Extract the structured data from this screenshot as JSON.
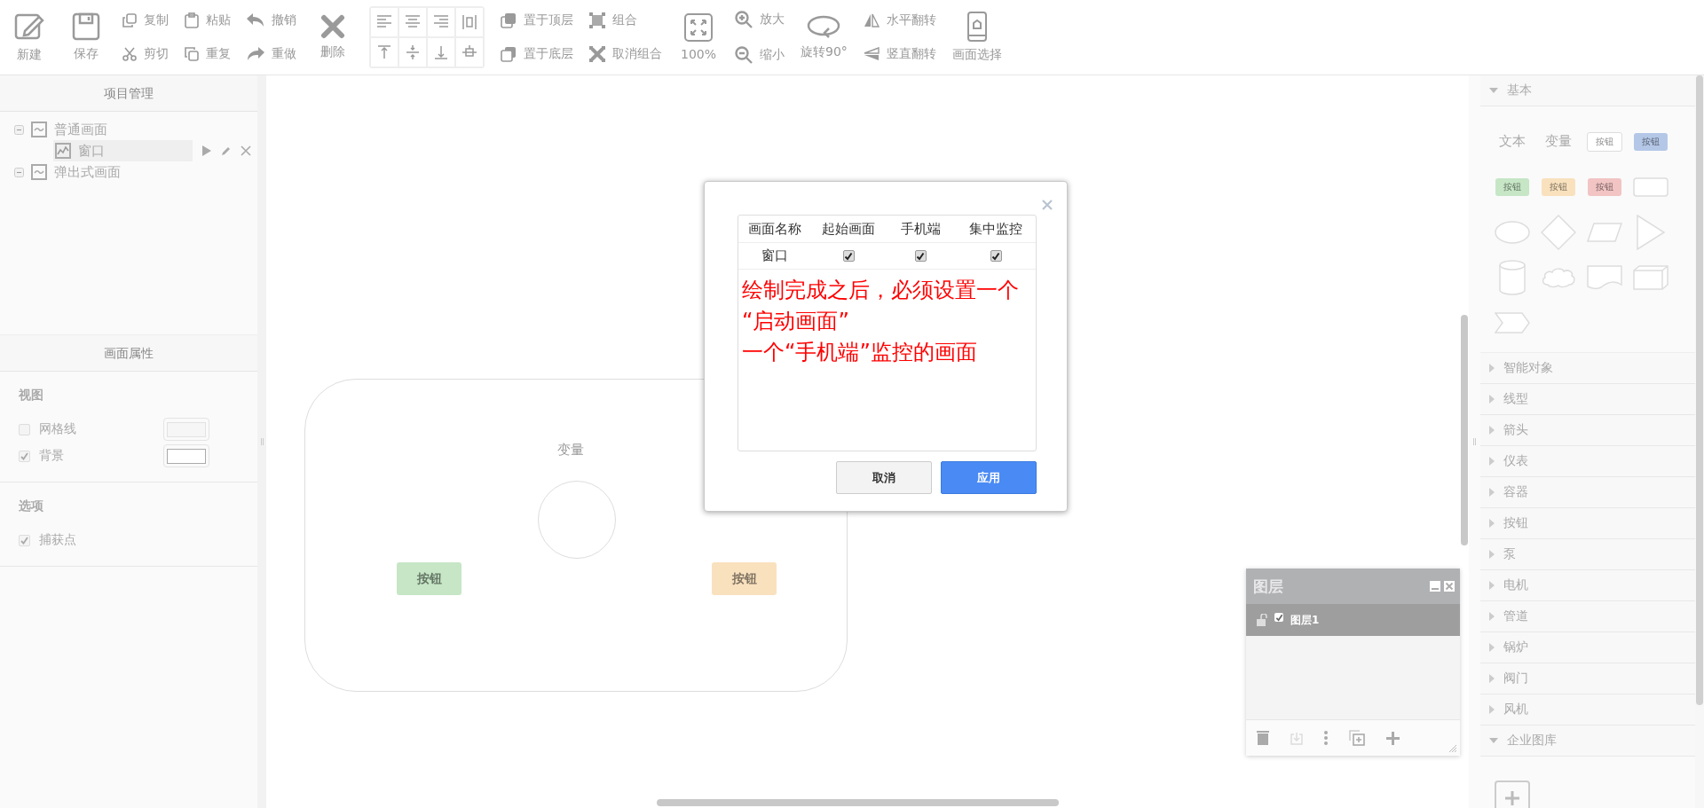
{
  "toolbar": {
    "new": "新建",
    "save": "保存",
    "copy": "复制",
    "cut": "剪切",
    "paste": "粘贴",
    "repeat": "重复",
    "undo": "撤销",
    "redo": "重做",
    "delete": "删除",
    "bring_front": "置于顶层",
    "send_back": "置于底层",
    "group": "组合",
    "ungroup": "取消组合",
    "zoom_reset": "100%",
    "zoom_in": "放大",
    "zoom_out": "缩小",
    "rotate": "旋转90°",
    "flip_h": "水平翻转",
    "flip_v": "竖直翻转",
    "screen_select": "画面选择"
  },
  "project_panel": {
    "title": "项目管理",
    "tree": [
      {
        "label": "普通画面",
        "expanded": true,
        "children": [
          {
            "label": "窗口",
            "selected": true
          }
        ]
      },
      {
        "label": "弹出式画面",
        "expanded": true
      }
    ]
  },
  "properties_panel": {
    "title": "画面属性",
    "sections": [
      {
        "title": "视图",
        "options": [
          {
            "label": "网格线",
            "checked": false,
            "kind": "swatch"
          },
          {
            "label": "背景",
            "checked": true,
            "kind": "swatch"
          }
        ]
      },
      {
        "title": "选项",
        "options": [
          {
            "label": "捕获点",
            "checked": true,
            "kind": "plain"
          }
        ]
      }
    ]
  },
  "canvas": {
    "items": [
      {
        "kind": "text",
        "label": "变量"
      },
      {
        "kind": "circle"
      },
      {
        "kind": "button",
        "label": "按钮",
        "color": "#c6e6c6"
      },
      {
        "kind": "button",
        "label": "按钮",
        "color": "#f9e1be"
      }
    ]
  },
  "dialog": {
    "columns": [
      "画面名称",
      "起始画面",
      "手机端",
      "集中监控"
    ],
    "rows": [
      {
        "name": "窗口",
        "cells": [
          {
            "checked": true
          },
          {
            "checked": true
          },
          {
            "checked": true
          }
        ]
      }
    ],
    "note": [
      "绘制完成之后，必须设置一个",
      "“启动画面”",
      "一个“手机端”监控的画面"
    ],
    "buttons": [
      {
        "label": "取消",
        "kind": "secondary"
      },
      {
        "label": "应用",
        "kind": "primary"
      }
    ]
  },
  "layers_panel": {
    "title": "图层",
    "layers": [
      {
        "name": "图层1",
        "visible": true,
        "locked": false,
        "selected": true
      }
    ]
  },
  "library": {
    "sections": [
      {
        "title": "基本",
        "expanded": true,
        "items": [
          {
            "kind": "text",
            "label": "文本"
          },
          {
            "kind": "text",
            "label": "变量"
          },
          {
            "kind": "outline-button",
            "label": "按钮"
          },
          {
            "kind": "button",
            "label": "按钮",
            "color": "#b4c7e7"
          },
          {
            "kind": "button",
            "label": "按钮",
            "color": "#c6e6c6"
          },
          {
            "kind": "button",
            "label": "按钮",
            "color": "#f9e1be"
          },
          {
            "kind": "button",
            "label": "按钮",
            "color": "#f2c4c4"
          },
          {
            "kind": "rect"
          },
          {
            "kind": "ellipse"
          },
          {
            "kind": "diamond"
          },
          {
            "kind": "parallelogram"
          },
          {
            "kind": "triangle"
          },
          {
            "kind": "cylinder"
          },
          {
            "kind": "cloud"
          },
          {
            "kind": "document"
          },
          {
            "kind": "cube"
          },
          {
            "kind": "chevron"
          }
        ]
      },
      {
        "title": "智能对象",
        "expanded": false
      },
      {
        "title": "线型",
        "expanded": false
      },
      {
        "title": "箭头",
        "expanded": false
      },
      {
        "title": "仪表",
        "expanded": false
      },
      {
        "title": "容器",
        "expanded": false
      },
      {
        "title": "按钮",
        "expanded": false
      },
      {
        "title": "泵",
        "expanded": false
      },
      {
        "title": "电机",
        "expanded": false
      },
      {
        "title": "管道",
        "expanded": false
      },
      {
        "title": "锅炉",
        "expanded": false
      },
      {
        "title": "阀门",
        "expanded": false
      },
      {
        "title": "风机",
        "expanded": false
      },
      {
        "title": "企业图库",
        "expanded": true,
        "items": [
          {
            "kind": "add"
          }
        ]
      }
    ]
  }
}
